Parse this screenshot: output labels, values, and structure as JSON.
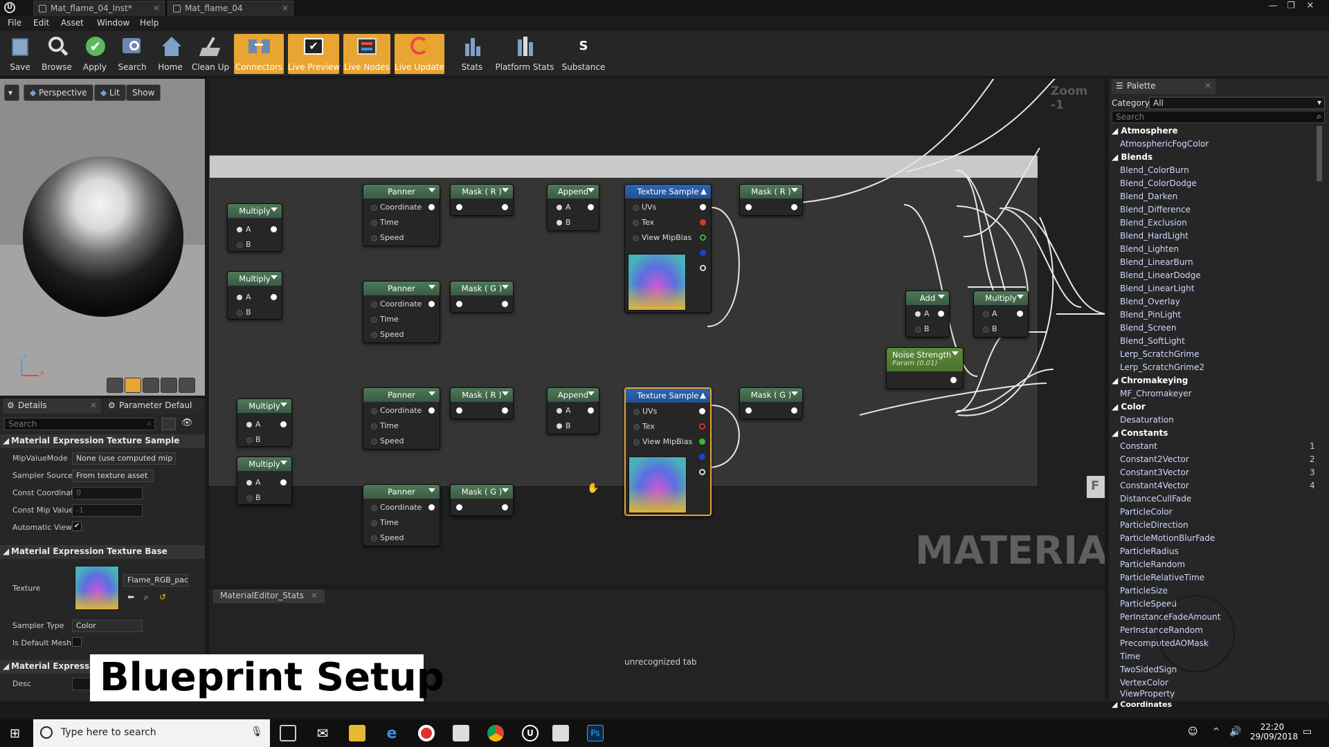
{
  "titlebar": {
    "tabs": [
      {
        "label": "Mat_flame_04_Inst*"
      },
      {
        "label": "Mat_flame_04"
      }
    ],
    "controls": {
      "minimize": "—",
      "restore": "❐",
      "close": "✕"
    }
  },
  "menu": [
    "File",
    "Edit",
    "Asset",
    "Window",
    "Help"
  ],
  "toolbar": [
    {
      "label": "Save",
      "active": false
    },
    {
      "label": "Browse",
      "active": false
    },
    {
      "label": "Apply",
      "active": false
    },
    {
      "label": "Search",
      "active": false
    },
    {
      "label": "Home",
      "active": false
    },
    {
      "label": "Clean Up",
      "active": false
    },
    {
      "label": "Connectors",
      "active": true
    },
    {
      "label": "Live Preview",
      "active": true
    },
    {
      "label": "Live Nodes",
      "active": true
    },
    {
      "label": "Live Update",
      "active": true
    },
    {
      "label": "Stats",
      "active": false
    },
    {
      "label": "Platform Stats",
      "active": false
    },
    {
      "label": "Substance",
      "active": false
    }
  ],
  "viewport": {
    "perspective": "Perspective",
    "lit": "Lit",
    "show": "Show",
    "axis_z": "z",
    "axis_x": "x"
  },
  "details": {
    "tabs": [
      {
        "label": "Details"
      },
      {
        "label": "Parameter Defaul"
      }
    ],
    "search_placeholder": "Search",
    "sections": {
      "texture_sample": "Material Expression Texture Sample",
      "texture_base": "Material Expression Texture Base",
      "expression": "Material Expression"
    },
    "props": {
      "mip_value_mode": {
        "label": "MipValueMode",
        "value": "None (use computed mip"
      },
      "sampler_source": {
        "label": "Sampler Source",
        "value": "From texture asset"
      },
      "const_coordinate": {
        "label": "Const Coordinat",
        "value": "0"
      },
      "const_mip_value": {
        "label": "Const Mip Value",
        "value": "-1"
      },
      "automatic_view": {
        "label": "Automatic View",
        "checked": true
      },
      "texture": {
        "label": "Texture",
        "value": "Flame_RGB_pac"
      },
      "sampler_type": {
        "label": "Sampler Type",
        "value": "Color"
      },
      "is_default_mesh": {
        "label": "Is Default Mesh",
        "checked": false
      },
      "desc": {
        "label": "Desc"
      }
    }
  },
  "graph": {
    "zoom": "Zoom -1",
    "watermark": "MATERIAL",
    "side_marker": "F",
    "nodes": {
      "multiply": "Multiply",
      "panner": "Panner",
      "mask_r": "Mask ( R )",
      "mask_g": "Mask ( G )",
      "append": "Append",
      "texture_sample": "Texture Sample",
      "add": "Add",
      "noise_strength": "Noise Strength",
      "noise_param": "Param (0.01)"
    },
    "pins": {
      "a": "A",
      "b": "B",
      "coordinate": "Coordinate",
      "time": "Time",
      "speed": "Speed",
      "uvs": "UVs",
      "tex": "Tex",
      "view_mip_bias": "View MipBias"
    }
  },
  "stats": {
    "tab": "MaterialEditor_Stats",
    "message": "unrecognized tab"
  },
  "palette": {
    "title": "Palette",
    "category_label": "Category:",
    "category_value": "All",
    "search_placeholder": "Search",
    "groups": {
      "atmosphere": "Atmosphere",
      "blends": "Blends",
      "chromakeying": "Chromakeying",
      "color": "Color",
      "constants": "Constants",
      "coordinates": "Coordinates"
    },
    "items": {
      "atmospheric_fog_color": "AtmosphericFogColor",
      "blend_colorburn": "Blend_ColorBurn",
      "blend_colordodge": "Blend_ColorDodge",
      "blend_darken": "Blend_Darken",
      "blend_difference": "Blend_Difference",
      "blend_exclusion": "Blend_Exclusion",
      "blend_hardlight": "Blend_HardLight",
      "blend_lighten": "Blend_Lighten",
      "blend_linearburn": "Blend_LinearBurn",
      "blend_lineardodge": "Blend_LinearDodge",
      "blend_linearlight": "Blend_LinearLight",
      "blend_overlay": "Blend_Overlay",
      "blend_pinlight": "Blend_PinLight",
      "blend_screen": "Blend_Screen",
      "blend_softlight": "Blend_SoftLight",
      "lerp_scratchgrime": "Lerp_ScratchGrime",
      "lerp_scratchgrime2": "Lerp_ScratchGrime2",
      "mf_chromakeyer": "MF_Chromakeyer",
      "desaturation": "Desaturation",
      "constant": "Constant",
      "constant2vector": "Constant2Vector",
      "constant3vector": "Constant3Vector",
      "constant4vector": "Constant4Vector",
      "distance_cull_fade": "DistanceCullFade",
      "particle_color": "ParticleColor",
      "particle_direction": "ParticleDirection",
      "particle_motion_blur_fade": "ParticleMotionBlurFade",
      "particle_radius": "ParticleRadius",
      "particle_random": "ParticleRandom",
      "particle_relative_time": "ParticleRelativeTime",
      "particle_size": "ParticleSize",
      "particle_speed": "ParticleSpeed",
      "per_instance_fade_amount": "PerInstanceFadeAmount",
      "per_instance_random": "PerInstanceRandom",
      "precomputed_ao_mask": "PrecomputedAOMask",
      "time": "Time",
      "two_sided_sign": "TwoSidedSign",
      "vertex_color": "VertexColor",
      "view_property": "ViewProperty"
    },
    "shortcuts": {
      "constant": "1",
      "constant2vector": "2",
      "constant3vector": "3",
      "constant4vector": "4"
    }
  },
  "caption": "Blueprint Setup",
  "taskbar": {
    "search_placeholder": "Type here to search",
    "time": "22:20",
    "date": "29/09/2018"
  },
  "colors": {
    "accent": "#e8a532",
    "node_header_green": "#4e7a58",
    "node_header_blue": "#2d66b5"
  }
}
